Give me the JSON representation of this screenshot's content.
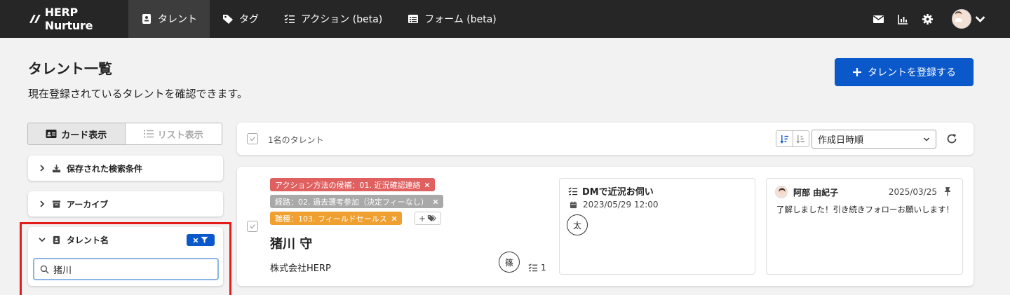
{
  "topnav": {
    "brand": "HERP Nurture",
    "items": [
      {
        "label": "タレント",
        "icon": "badge-icon",
        "active": true
      },
      {
        "label": "タグ",
        "icon": "tag-icon",
        "active": false
      },
      {
        "label": "アクション (beta)",
        "icon": "checklist-icon",
        "active": false
      },
      {
        "label": "フォーム (beta)",
        "icon": "form-icon",
        "active": false
      }
    ],
    "right_icons": [
      "mail-icon",
      "chart-icon",
      "gear-icon",
      "avatar",
      "chevron-down-icon"
    ]
  },
  "header": {
    "title": "タレント一覧",
    "description": "現在登録されているタレントを確認できます。",
    "register_label": "タレントを登録する",
    "accent": "#0a58ca"
  },
  "view_toggle": {
    "card_label": "カード表示",
    "list_label": "リスト表示"
  },
  "filters": {
    "saved_search": "保存された検索条件",
    "archive": "アーカイブ",
    "talent_name": {
      "label": "タレント名",
      "value": "猪川"
    }
  },
  "list_header": {
    "count": "1名のタレント",
    "sort_value": "作成日時順"
  },
  "talent": {
    "tags": [
      {
        "label": "アクション方法の候補：01. 近況確認連絡",
        "color": "#e06060"
      },
      {
        "label": "経路：02. 過去選考参加（決定フィーなし）",
        "color": "#a9a9a9"
      },
      {
        "label": "職種：103. フィールドセールス",
        "color": "#f0a030"
      }
    ],
    "add_tag": "+",
    "name": "猪川 守",
    "company": "株式会社HERP",
    "owner_initial": "篠",
    "action_count": "1"
  },
  "action": {
    "title": "DMで近況お伺い",
    "datetime": "2023/05/29 12:00",
    "assignee_initial": "太"
  },
  "memo": {
    "author": "阿部 由紀子",
    "date": "2025/03/25",
    "body": "了解しました！引き続きフォローお願いします！"
  }
}
